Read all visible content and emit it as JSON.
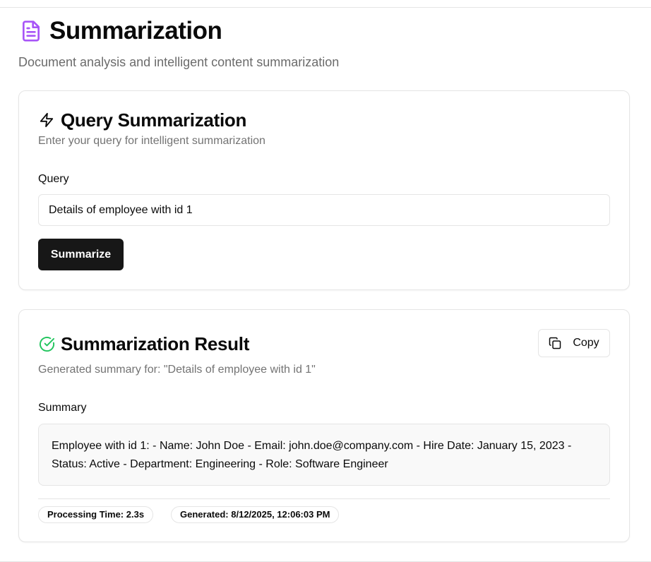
{
  "page": {
    "title": "Summarization",
    "subtitle": "Document analysis and intelligent content summarization",
    "icon": "file-text-icon",
    "accent_color": "#a855f7"
  },
  "query_card": {
    "icon": "zap-icon",
    "title": "Query Summarization",
    "description": "Enter your query for intelligent summarization",
    "query_label": "Query",
    "query_value": "Details of employee with id 1",
    "submit_label": "Summarize"
  },
  "result_card": {
    "icon": "check-circle-icon",
    "icon_color": "#22c55e",
    "title": "Summarization Result",
    "description": "Generated summary for: \"Details of employee with id 1\"",
    "copy_label": "Copy",
    "summary_label": "Summary",
    "summary_text": "Employee with id 1: - Name: John Doe - Email: john.doe@company.com - Hire Date: January 15, 2023 - Status: Active - Department: Engineering - Role: Software Engineer",
    "processing_time": "Processing Time: 2.3s",
    "generated_at": "Generated: 8/12/2025, 12:06:03 PM"
  }
}
